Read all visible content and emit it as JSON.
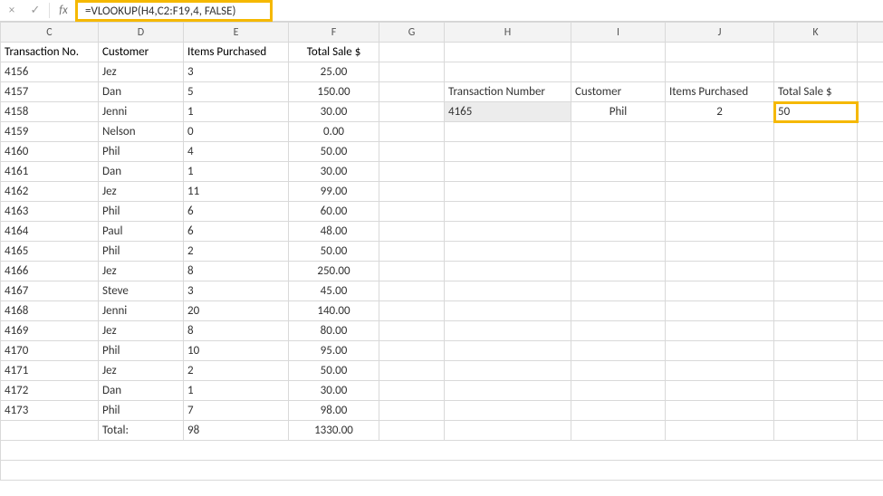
{
  "formula_bar": {
    "cancel_glyph": "×",
    "accept_glyph": "✓",
    "fx_label": "fx",
    "formula": "=VLOOKUP(H4,C2:F19,4, FALSE)"
  },
  "columns": [
    "C",
    "D",
    "E",
    "F",
    "G",
    "H",
    "I",
    "J",
    "K"
  ],
  "headers": {
    "transaction_no": "Transaction No.",
    "customer": "Customer",
    "items_purchased": "Items Purchased",
    "total_sale": "Total Sale $"
  },
  "rows": [
    {
      "txn": "4156",
      "cust": "Jez",
      "items": "3",
      "sale": "25.00"
    },
    {
      "txn": "4157",
      "cust": "Dan",
      "items": "5",
      "sale": "150.00"
    },
    {
      "txn": "4158",
      "cust": "Jenni",
      "items": "1",
      "sale": "30.00"
    },
    {
      "txn": "4159",
      "cust": "Nelson",
      "items": "0",
      "sale": "0.00"
    },
    {
      "txn": "4160",
      "cust": "Phil",
      "items": "4",
      "sale": "50.00"
    },
    {
      "txn": "4161",
      "cust": "Dan",
      "items": "1",
      "sale": "30.00"
    },
    {
      "txn": "4162",
      "cust": "Jez",
      "items": "11",
      "sale": "99.00"
    },
    {
      "txn": "4163",
      "cust": "Phil",
      "items": "6",
      "sale": "60.00"
    },
    {
      "txn": "4164",
      "cust": "Paul",
      "items": "6",
      "sale": "48.00"
    },
    {
      "txn": "4165",
      "cust": "Phil",
      "items": "2",
      "sale": "50.00"
    },
    {
      "txn": "4166",
      "cust": "Jez",
      "items": "8",
      "sale": "250.00"
    },
    {
      "txn": "4167",
      "cust": "Steve",
      "items": "3",
      "sale": "45.00"
    },
    {
      "txn": "4168",
      "cust": "Jenni",
      "items": "20",
      "sale": "140.00"
    },
    {
      "txn": "4169",
      "cust": "Jez",
      "items": "8",
      "sale": "80.00"
    },
    {
      "txn": "4170",
      "cust": "Phil",
      "items": "10",
      "sale": "95.00"
    },
    {
      "txn": "4171",
      "cust": "Jez",
      "items": "2",
      "sale": "50.00"
    },
    {
      "txn": "4172",
      "cust": "Dan",
      "items": "1",
      "sale": "30.00"
    },
    {
      "txn": "4173",
      "cust": "Phil",
      "items": "7",
      "sale": "98.00"
    }
  ],
  "totals": {
    "label": "Total:",
    "items": "98",
    "sale": "1330.00"
  },
  "lookup": {
    "headers": {
      "txn": "Transaction Number",
      "cust": "Customer",
      "items": "Items Purchased",
      "sale": "Total Sale $"
    },
    "txn": "4165",
    "cust": "Phil",
    "items": "2",
    "sale": "50"
  }
}
